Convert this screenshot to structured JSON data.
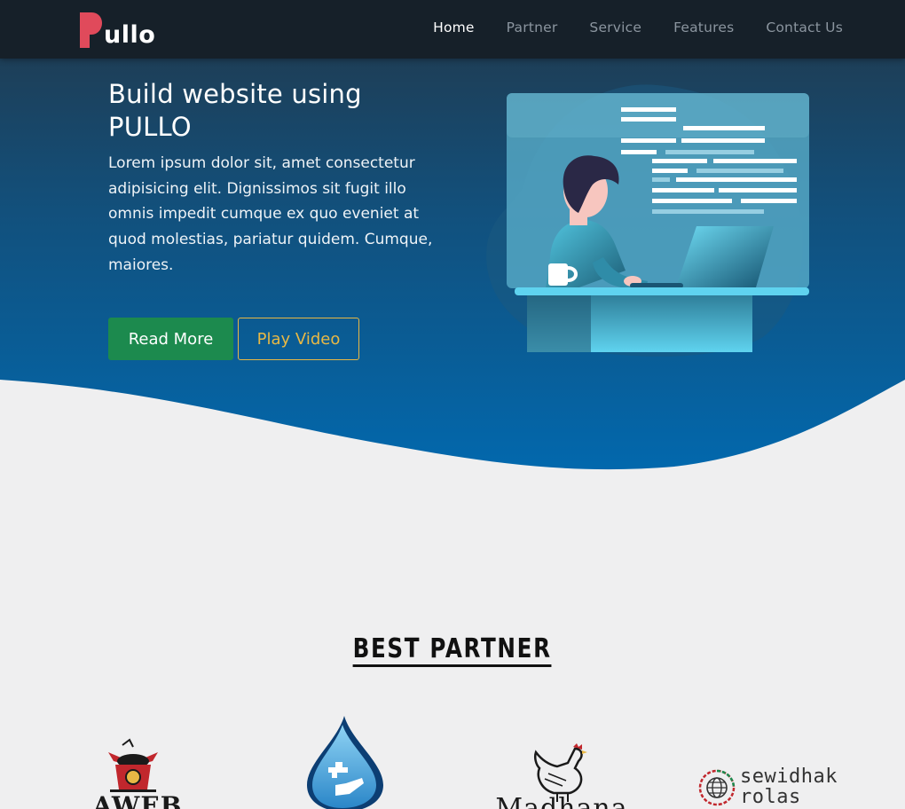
{
  "brand": {
    "name": "ullo",
    "logo_letter": "P"
  },
  "nav": {
    "items": [
      {
        "label": "Home",
        "active": true
      },
      {
        "label": "Partner",
        "active": false
      },
      {
        "label": "Service",
        "active": false
      },
      {
        "label": "Features",
        "active": false
      },
      {
        "label": "Contact Us",
        "active": false
      }
    ]
  },
  "hero": {
    "title": "Build website using PULLO",
    "text": "Lorem ipsum dolor sit, amet consectetur adipisicing elit. Dignissimos sit fugit illo omnis impedit cumque ex quo eveniet at quod molestias, pariatur quidem. Cumque, maiores.",
    "read_more_label": "Read More",
    "play_video_label": "Play Video"
  },
  "partners": {
    "heading": "BEST PARTNER",
    "logos": [
      {
        "icon": "noodle-box-icon",
        "text": "AWEB"
      },
      {
        "icon": "water-drop-icon",
        "text": ""
      },
      {
        "icon": "rooster-icon",
        "text": "Madhana"
      },
      {
        "icon": "globe-icon",
        "text": "sewidhak rolas"
      }
    ]
  },
  "colors": {
    "navbar": "#162029",
    "hero_top": "#22384a",
    "hero_bottom": "#0268ad",
    "read_more": "#1c8a4e",
    "play_video": "#e8b845",
    "logo_p": "#e04a5b",
    "page_bg": "#efeff0"
  }
}
